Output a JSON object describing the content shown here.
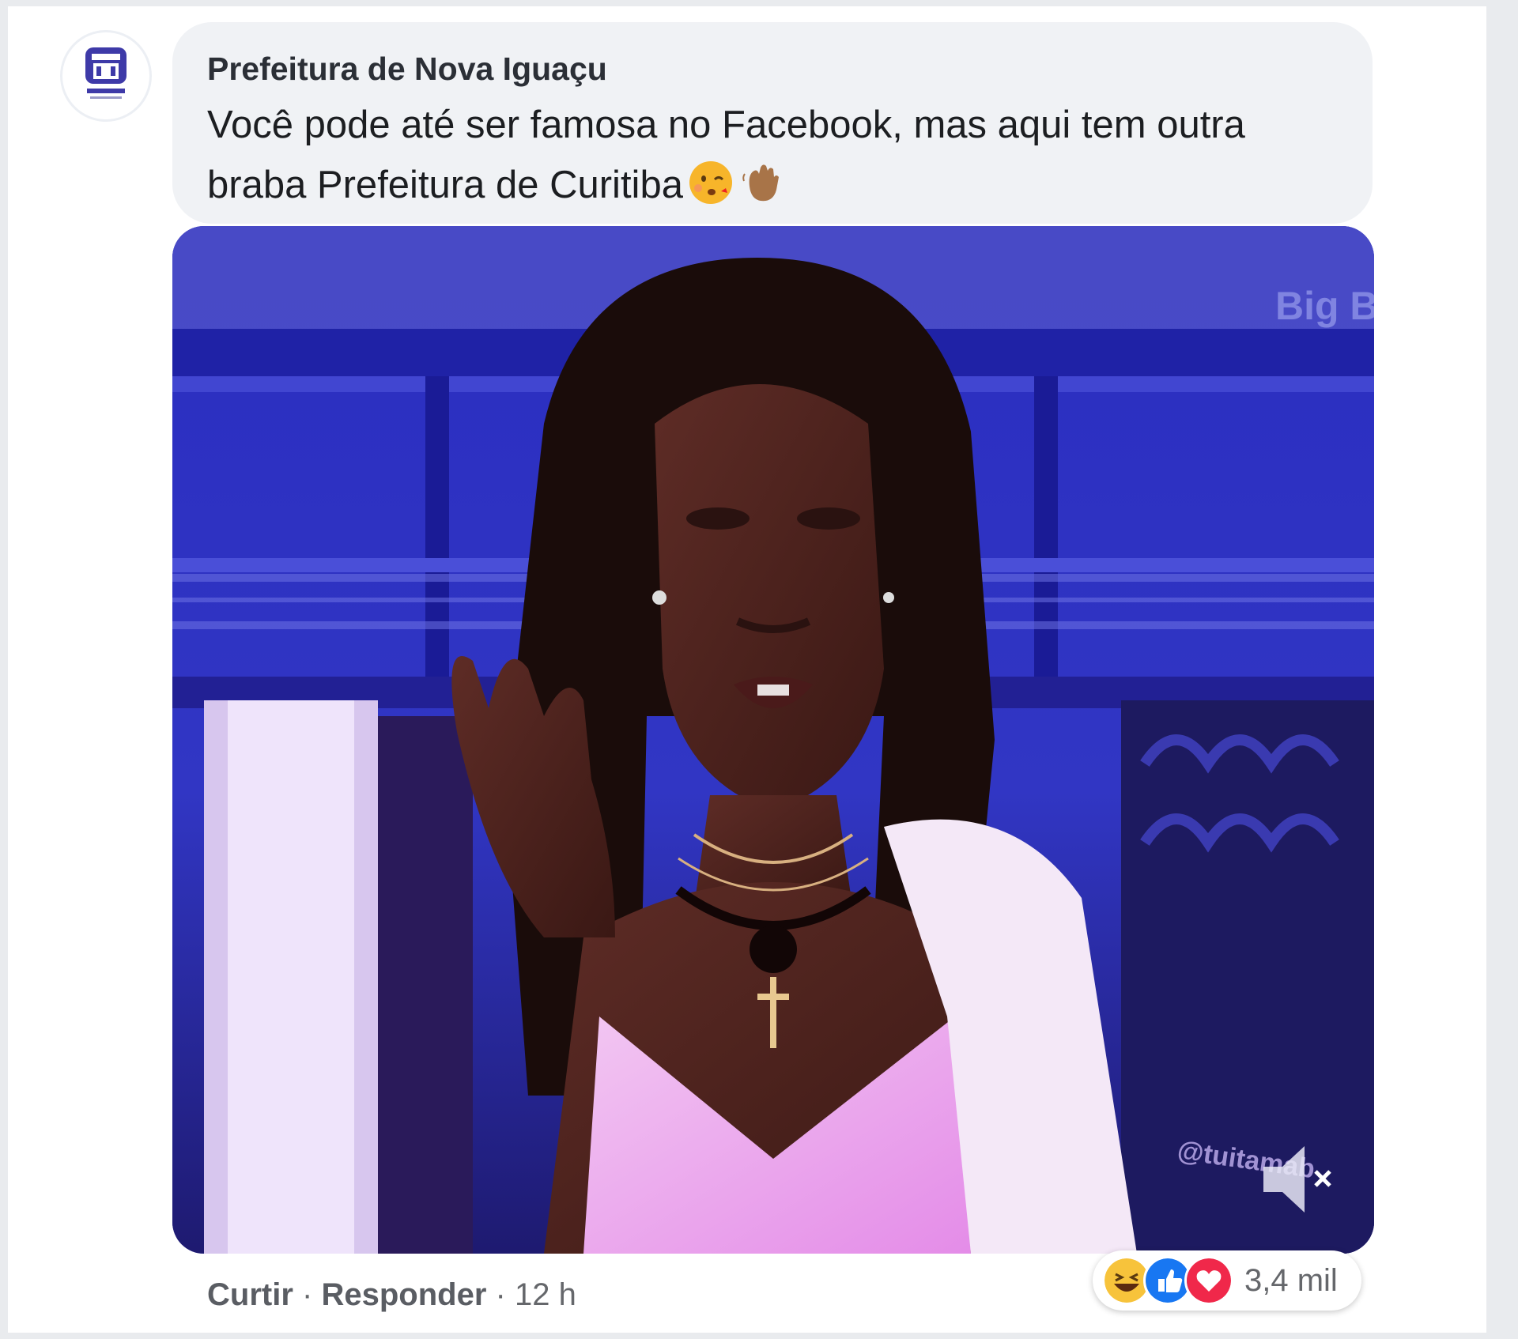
{
  "comment": {
    "author": "Prefeitura de Nova Iguaçu",
    "text": "Você pode até ser famosa no Facebook, mas aqui tem outra braba Prefeitura de Curitiba",
    "emojis": [
      "kissing-face-emoji",
      "waving-hand-emoji"
    ]
  },
  "video": {
    "channel_watermark": "Big Brother",
    "user_watermark": "@tuitamab",
    "mute_icon": "speaker-muted-icon"
  },
  "actions": {
    "like": "Curtir",
    "separator": "·",
    "reply": "Responder",
    "time": "12 h"
  },
  "reactions": {
    "icons": [
      "haha-icon",
      "like-icon",
      "love-icon"
    ],
    "count": "3,4 mil"
  },
  "colors": {
    "bubble": "#f0f2f5",
    "text": "#1c1e21",
    "meta": "#65676b"
  }
}
